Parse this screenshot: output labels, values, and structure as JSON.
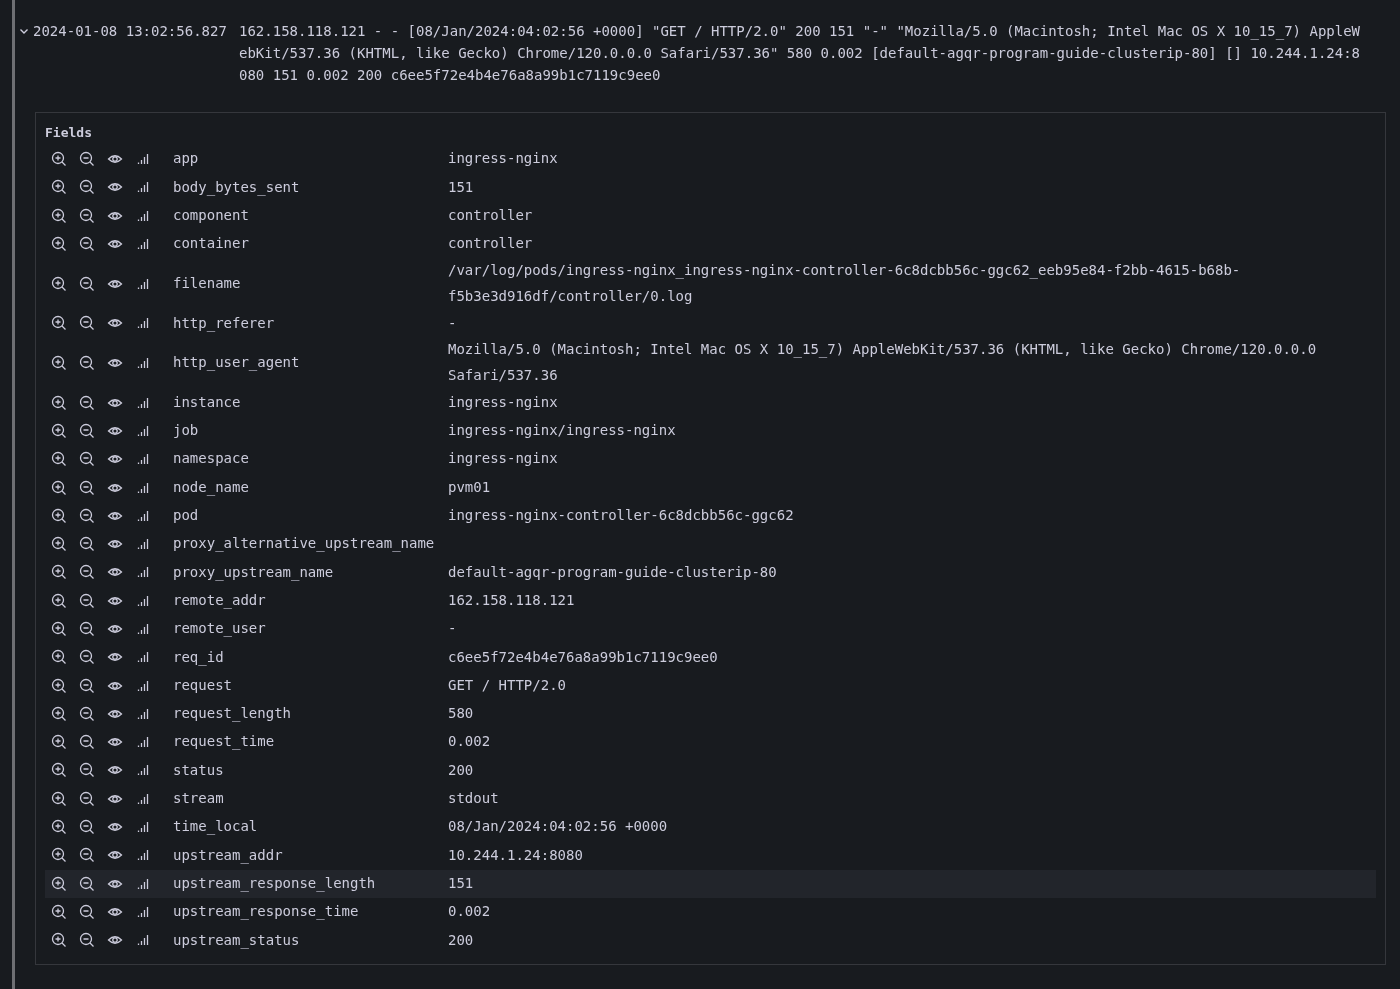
{
  "log_entry": {
    "expanded": true,
    "timestamp": "2024-01-08 13:02:56.827",
    "message": "162.158.118.121 - - [08/Jan/2024:04:02:56 +0000] \"GET / HTTP/2.0\" 200 151 \"-\" \"Mozilla/5.0 (Macintosh; Intel Mac OS X 10_15_7) AppleWebKit/537.36 (KHTML, like Gecko) Chrome/120.0.0.0 Safari/537.36\" 580 0.002 [default-agqr-program-guide-clusterip-80] [] 10.244.1.24:8080 151 0.002 200 c6ee5f72e4b4e76a8a99b1c7119c9ee0"
  },
  "fields_panel": {
    "title": "Fields",
    "rows": [
      {
        "key": "app",
        "value": "ingress-nginx",
        "selected": false
      },
      {
        "key": "body_bytes_sent",
        "value": "151",
        "selected": false
      },
      {
        "key": "component",
        "value": "controller",
        "selected": false
      },
      {
        "key": "container",
        "value": "controller",
        "selected": false
      },
      {
        "key": "filename",
        "value": "/var/log/pods/ingress-nginx_ingress-nginx-controller-6c8dcbb56c-ggc62_eeb95e84-f2bb-4615-b68b-f5b3e3d916df/controller/0.log",
        "selected": false
      },
      {
        "key": "http_referer",
        "value": "-",
        "selected": false
      },
      {
        "key": "http_user_agent",
        "value": "Mozilla/5.0 (Macintosh; Intel Mac OS X 10_15_7) AppleWebKit/537.36 (KHTML, like Gecko) Chrome/120.0.0.0 Safari/537.36",
        "selected": false
      },
      {
        "key": "instance",
        "value": "ingress-nginx",
        "selected": false
      },
      {
        "key": "job",
        "value": "ingress-nginx/ingress-nginx",
        "selected": false
      },
      {
        "key": "namespace",
        "value": "ingress-nginx",
        "selected": false
      },
      {
        "key": "node_name",
        "value": "pvm01",
        "selected": false
      },
      {
        "key": "pod",
        "value": "ingress-nginx-controller-6c8dcbb56c-ggc62",
        "selected": false
      },
      {
        "key": "proxy_alternative_upstream_name",
        "selected": false
      },
      {
        "key": "proxy_upstream_name",
        "value": "default-agqr-program-guide-clusterip-80",
        "selected": false
      },
      {
        "key": "remote_addr",
        "value": "162.158.118.121",
        "selected": false
      },
      {
        "key": "remote_user",
        "value": "-",
        "selected": false
      },
      {
        "key": "req_id",
        "value": "c6ee5f72e4b4e76a8a99b1c7119c9ee0",
        "selected": false
      },
      {
        "key": "request",
        "value": "GET / HTTP/2.0",
        "selected": false
      },
      {
        "key": "request_length",
        "value": "580",
        "selected": false
      },
      {
        "key": "request_time",
        "value": "0.002",
        "selected": false
      },
      {
        "key": "status",
        "value": "200",
        "selected": false
      },
      {
        "key": "stream",
        "value": "stdout",
        "selected": false
      },
      {
        "key": "time_local",
        "value": "08/Jan/2024:04:02:56 +0000",
        "selected": false
      },
      {
        "key": "upstream_addr",
        "value": "10.244.1.24:8080",
        "selected": false
      },
      {
        "key": "upstream_response_length",
        "value": "151",
        "selected": true
      },
      {
        "key": "upstream_response_time",
        "value": "0.002",
        "selected": false
      },
      {
        "key": "upstream_status",
        "value": "200",
        "selected": false
      }
    ]
  }
}
